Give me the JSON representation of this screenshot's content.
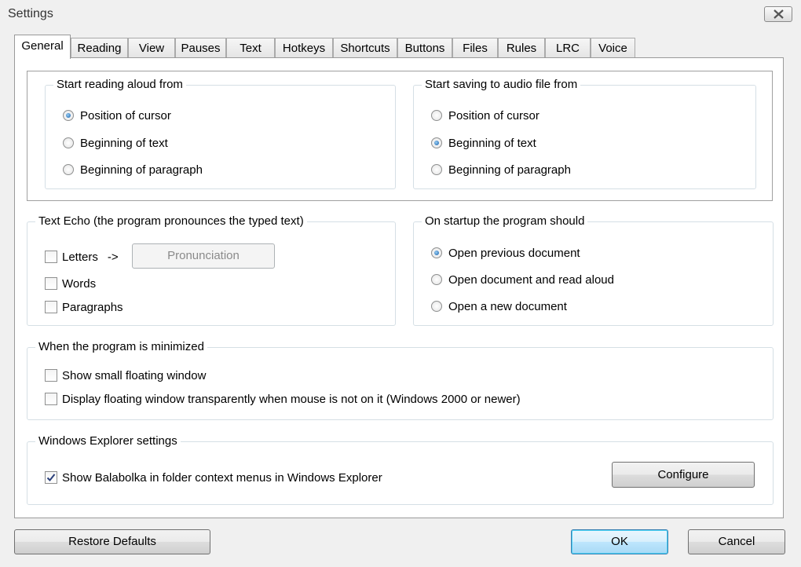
{
  "window": {
    "title": "Settings",
    "close_icon": "close-icon"
  },
  "tabs": [
    {
      "label": "General",
      "active": true
    },
    {
      "label": "Reading"
    },
    {
      "label": "View"
    },
    {
      "label": "Pauses"
    },
    {
      "label": "Text"
    },
    {
      "label": "Hotkeys"
    },
    {
      "label": "Shortcuts"
    },
    {
      "label": "Buttons"
    },
    {
      "label": "Files"
    },
    {
      "label": "Rules"
    },
    {
      "label": "LRC"
    },
    {
      "label": "Voice"
    }
  ],
  "reading": {
    "legend": "Start reading aloud from",
    "options": [
      "Position of cursor",
      "Beginning of text",
      "Beginning of paragraph"
    ],
    "selected": "Position of cursor"
  },
  "saving": {
    "legend": "Start saving to audio file from",
    "options": [
      "Position of cursor",
      "Beginning of text",
      "Beginning of paragraph"
    ],
    "selected": "Beginning of text"
  },
  "echo": {
    "legend": "Text Echo (the program pronounces the typed text)",
    "letters": "Letters",
    "arrow": "->",
    "pronunciation_button": "Pronunciation",
    "words": "Words",
    "paragraphs": "Paragraphs",
    "letters_checked": false,
    "words_checked": false,
    "paragraphs_checked": false
  },
  "startup": {
    "legend": "On startup the program should",
    "options": [
      "Open previous document",
      "Open document and read aloud",
      "Open a new document"
    ],
    "selected": "Open previous document"
  },
  "minimized": {
    "legend": "When the program is minimized",
    "show_floating": "Show small floating window",
    "transparent": "Display floating window transparently when mouse is not on it (Windows 2000 or newer)",
    "show_floating_checked": false,
    "transparent_checked": false
  },
  "explorer": {
    "legend": "Windows Explorer settings",
    "context_menu": "Show Balabolka in folder context menus in Windows Explorer",
    "context_menu_checked": true,
    "configure_button": "Configure"
  },
  "footer": {
    "restore": "Restore Defaults",
    "ok": "OK",
    "cancel": "Cancel"
  }
}
